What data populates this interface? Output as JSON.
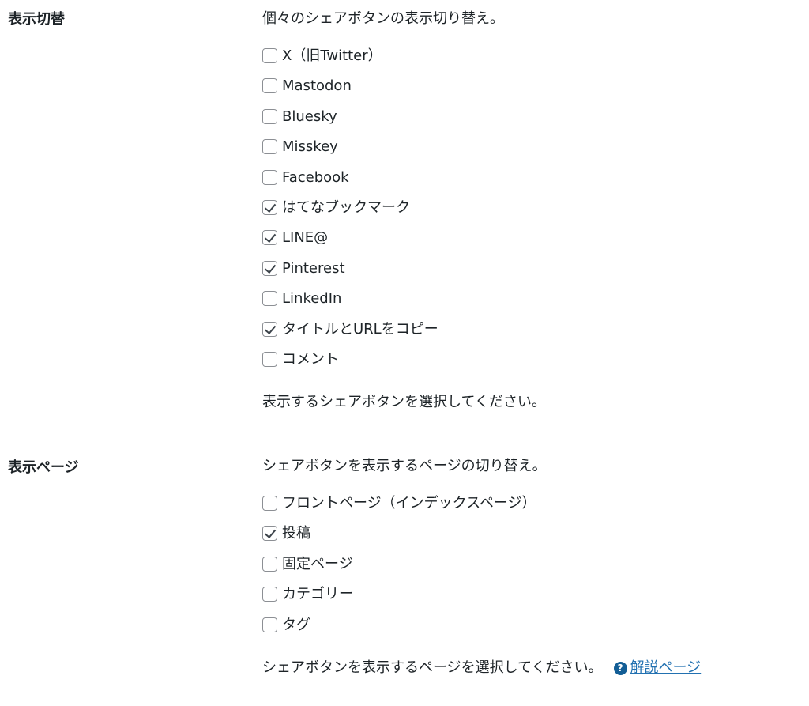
{
  "display_toggle": {
    "label": "表示切替",
    "description": "個々のシェアボタンの表示切り替え。",
    "options": [
      {
        "label": "X（旧Twitter）",
        "checked": false
      },
      {
        "label": "Mastodon",
        "checked": false
      },
      {
        "label": "Bluesky",
        "checked": false
      },
      {
        "label": "Misskey",
        "checked": false
      },
      {
        "label": "Facebook",
        "checked": false
      },
      {
        "label": "はてなブックマーク",
        "checked": true
      },
      {
        "label": "LINE@",
        "checked": true
      },
      {
        "label": "Pinterest",
        "checked": true
      },
      {
        "label": "LinkedIn",
        "checked": false
      },
      {
        "label": "タイトルとURLをコピー",
        "checked": true
      },
      {
        "label": "コメント",
        "checked": false
      }
    ],
    "help": "表示するシェアボタンを選択してください。"
  },
  "display_pages": {
    "label": "表示ページ",
    "description": "シェアボタンを表示するページの切り替え。",
    "options": [
      {
        "label": "フロントページ（インデックスページ）",
        "checked": false
      },
      {
        "label": "投稿",
        "checked": true
      },
      {
        "label": "固定ページ",
        "checked": false
      },
      {
        "label": "カテゴリー",
        "checked": false
      },
      {
        "label": "タグ",
        "checked": false
      }
    ],
    "help": "シェアボタンを表示するページを選択してください。",
    "help_icon": "question-circle-icon",
    "help_link": "解説ページ"
  },
  "colors": {
    "link": "#2271b1",
    "help_icon_bg": "#135e96",
    "checkbox_border": "#8c8f94"
  }
}
